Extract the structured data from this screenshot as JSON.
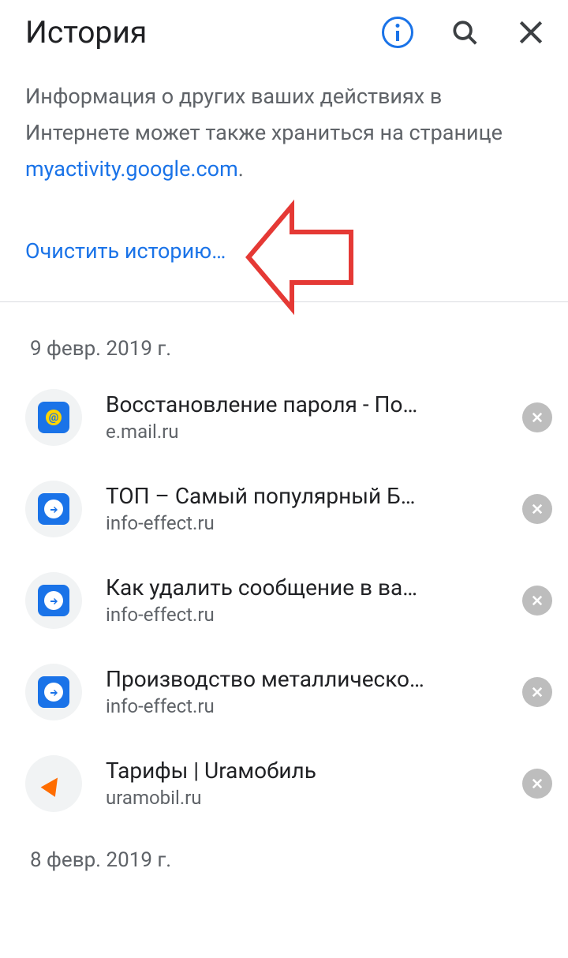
{
  "header": {
    "title": "История"
  },
  "banner": {
    "text_before": "Информация о других ваших действиях в Интернете может также храниться на странице ",
    "link": "myactivity.google.com",
    "text_after": ".",
    "clear_label": "Очистить историю…"
  },
  "sections": [
    {
      "date": "9 февр. 2019 г.",
      "entries": [
        {
          "title": "Восстановление пароля - По…",
          "domain": "e.mail.ru",
          "icon": "mail"
        },
        {
          "title": "ТОП – Самый популярный Б…",
          "domain": "info-effect.ru",
          "icon": "blue-arrow"
        },
        {
          "title": "Как удалить сообщение в ва…",
          "domain": "info-effect.ru",
          "icon": "blue-arrow"
        },
        {
          "title": "Производство металлическо…",
          "domain": "info-effect.ru",
          "icon": "blue-arrow"
        },
        {
          "title": "Тарифы | Uraмобиль",
          "domain": "uramobil.ru",
          "icon": "ura"
        }
      ]
    },
    {
      "date": "8 февр. 2019 г.",
      "entries": []
    }
  ],
  "colors": {
    "accent": "#1a73e8",
    "annotation": "#e53935"
  }
}
